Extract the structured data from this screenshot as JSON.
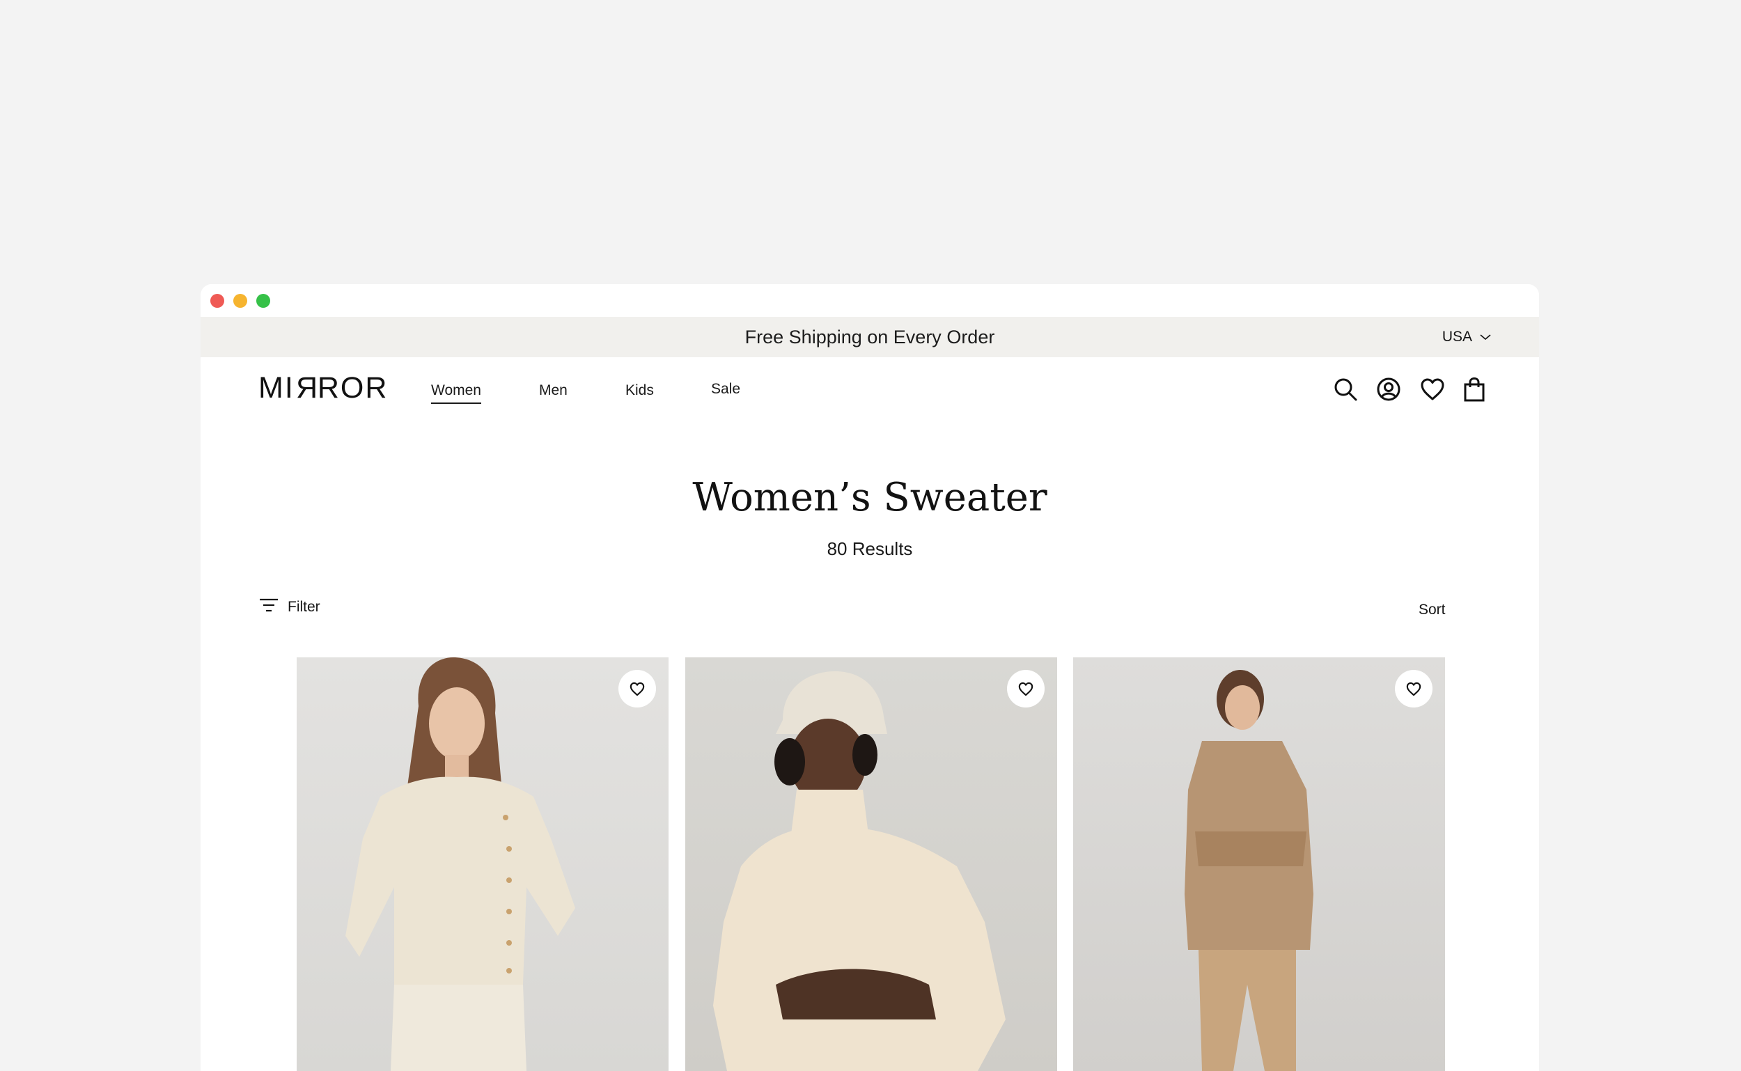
{
  "announcement": {
    "text": "Free Shipping on Every Order",
    "region": "USA"
  },
  "header": {
    "logo_left": "MI",
    "logo_rev": "R",
    "logo_right": "ROR",
    "nav": [
      "Women",
      "Men",
      "Kids",
      "Sale"
    ],
    "active_nav": "Women",
    "icons": [
      "search-icon",
      "account-icon",
      "heart-icon",
      "bag-icon"
    ]
  },
  "page": {
    "title": "Women’s Sweater",
    "results": "80 Results",
    "filter_label": "Filter",
    "sort_label": "Sort"
  },
  "products": [
    {
      "description": "Cream button cardigan sweater",
      "sweater_color": "#ece4d3"
    },
    {
      "description": "Cream turtleneck sweater with cap",
      "sweater_color": "#efe3cf"
    },
    {
      "description": "Camel knit shirt jacket and trousers",
      "sweater_color": "#b79573"
    }
  ],
  "colors": {
    "background": "#f3f3f3",
    "announcement_bar": "#f1f0ed",
    "text": "#151515"
  }
}
